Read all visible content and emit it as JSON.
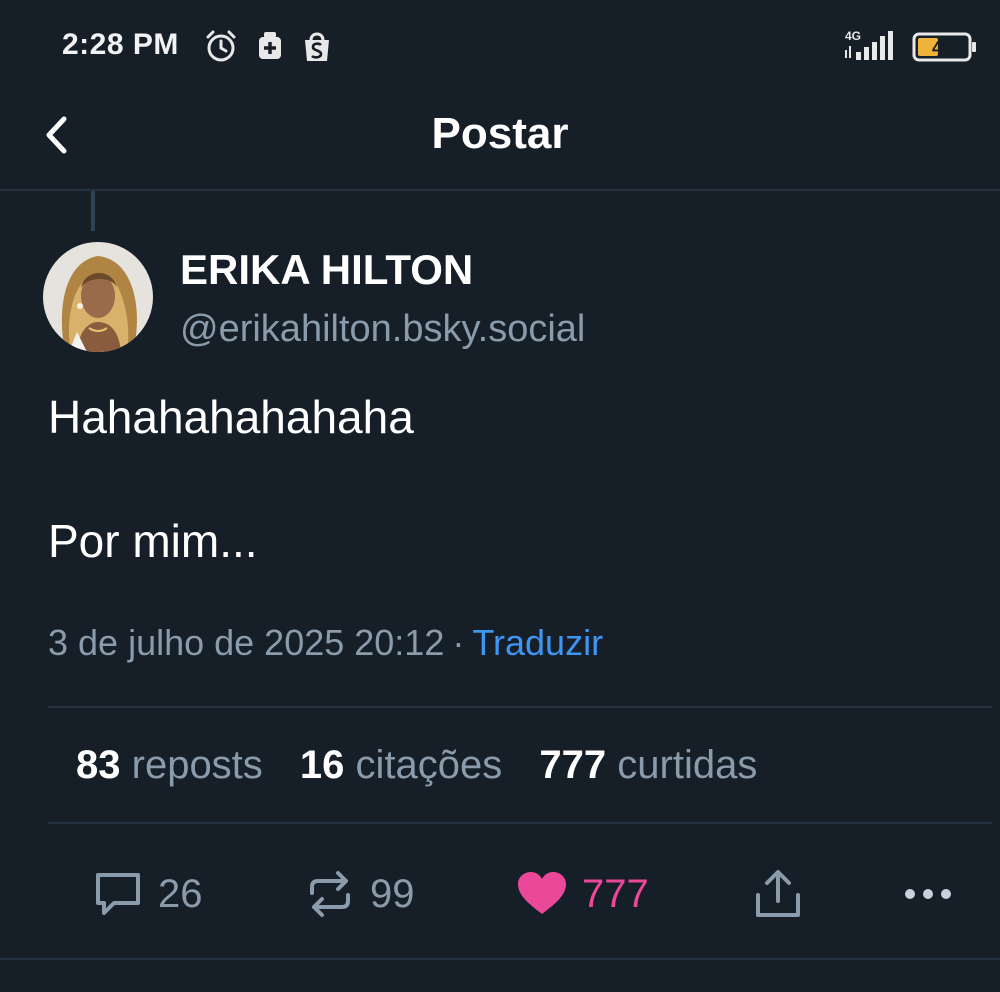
{
  "status_bar": {
    "time": "2:28 PM",
    "network": "4G",
    "battery": "40",
    "icons": [
      "alarm-icon",
      "medical-app-icon",
      "shopee-icon",
      "signal-icon",
      "battery-icon"
    ]
  },
  "header": {
    "title": "Postar",
    "back_icon": "chevron-left-icon"
  },
  "post": {
    "author_name": "ERIKA HILTON",
    "author_handle": "@erikahilton.bsky.social",
    "text": "Hahahahahahaha\n\nPor mim...",
    "timestamp": "3 de julho de 2025 20:12",
    "separator": "·",
    "translate_label": "Traduzir"
  },
  "stats": [
    {
      "count": "83",
      "label": "reposts"
    },
    {
      "count": "16",
      "label": "citações"
    },
    {
      "count": "777",
      "label": "curtidas"
    }
  ],
  "actions": {
    "reply_count": "26",
    "repost_count": "99",
    "like_count": "777",
    "like_active": true
  },
  "colors": {
    "background": "#161e27",
    "muted_text": "#8a9bab",
    "link": "#3e95f2",
    "like": "#ec4899",
    "divider": "#243240"
  }
}
